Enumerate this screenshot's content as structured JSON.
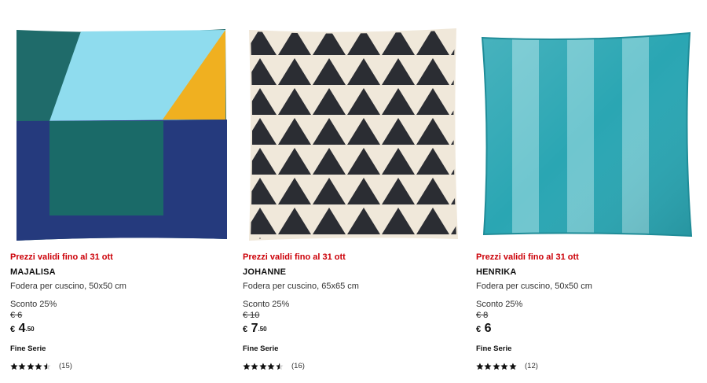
{
  "products": [
    {
      "promo": "Prezzi validi fino al 31 ott",
      "name": "MAJALISA",
      "description": "Fodera per cuscino, 50x50 cm",
      "discount": "Sconto 25%",
      "old_price": "€ 6",
      "price": {
        "currency": "€",
        "integer": "4",
        "decimals": ".50"
      },
      "badge": "Fine Serie",
      "rating": {
        "value": 4.5,
        "max": 5,
        "count": "(15)"
      },
      "colors": [
        "#1f6b6a",
        "#8fdcee",
        "#f0b020",
        "#253a7d"
      ]
    },
    {
      "promo": "Prezzi validi fino al 31 ott",
      "name": "JOHANNE",
      "description": "Fodera per cuscino, 65x65 cm",
      "discount": "Sconto 25%",
      "old_price": "€ 10",
      "price": {
        "currency": "€",
        "integer": "7",
        "decimals": ".50"
      },
      "badge": "Fine Serie",
      "rating": {
        "value": 4.5,
        "max": 5,
        "count": "(16)"
      },
      "colors": [
        "#f0e8da",
        "#2b2d33"
      ]
    },
    {
      "promo": "Prezzi validi fino al 31 ott",
      "name": "HENRIKA",
      "description": "Fodera per cuscino, 50x50 cm",
      "discount": "Sconto 25%",
      "old_price": "€ 8",
      "price": {
        "currency": "€",
        "integer": "6",
        "decimals": ""
      },
      "badge": "Fine Serie",
      "rating": {
        "value": 5,
        "max": 5,
        "count": "(12)"
      },
      "colors": [
        "#2aa6b3",
        "#6fc6cf"
      ]
    }
  ],
  "accent_color": "#cc0008"
}
